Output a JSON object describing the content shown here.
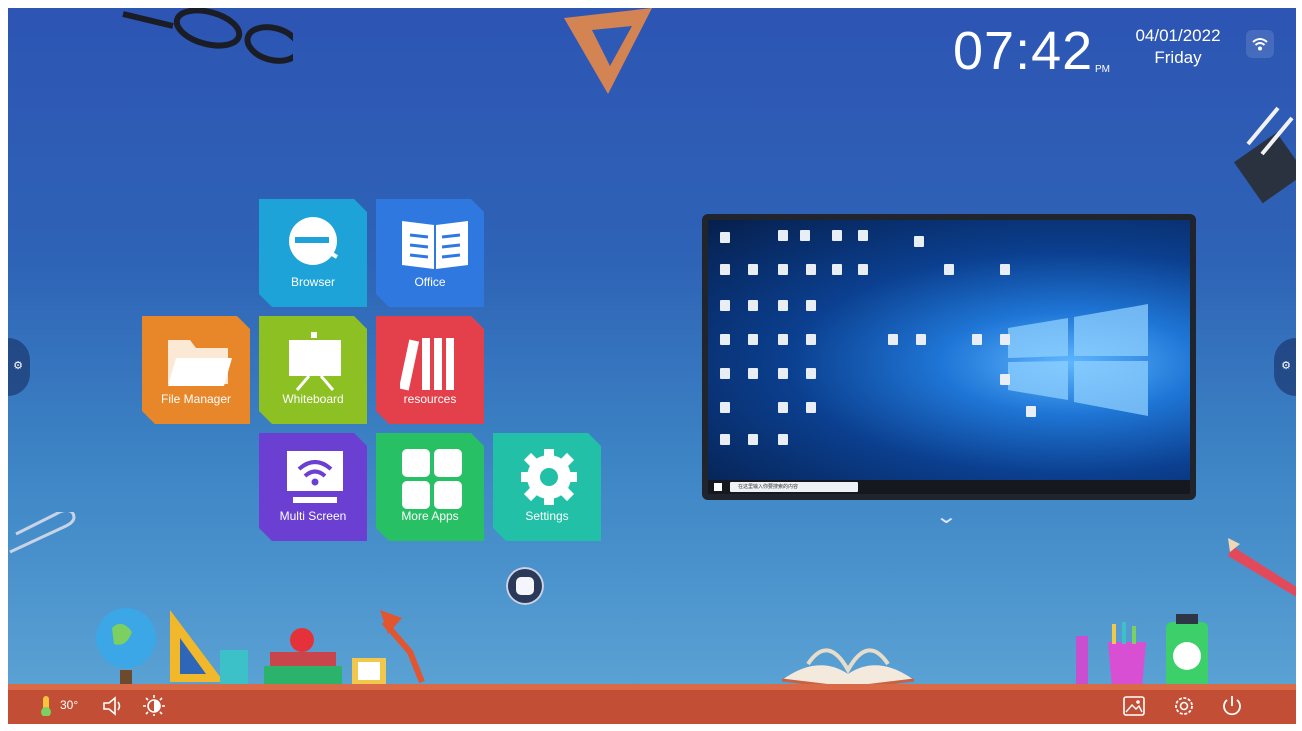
{
  "status": {
    "time": "07:42",
    "ampm": "PM",
    "date": "04/01/2022",
    "weekday": "Friday"
  },
  "apps": [
    {
      "label": "Browser",
      "color": "#1ea3d8",
      "icon": "browser-icon"
    },
    {
      "label": "Office",
      "color": "#2f78e0",
      "icon": "book-icon"
    },
    {
      "label": "File Manager",
      "color": "#e8862a",
      "icon": "folder-icon"
    },
    {
      "label": "Whiteboard",
      "color": "#8cc023",
      "icon": "easel-icon"
    },
    {
      "label": "resources",
      "color": "#e4404b",
      "icon": "books-icon"
    },
    {
      "label": "Multi Screen",
      "color": "#6a3fd2",
      "icon": "cast-icon"
    },
    {
      "label": "More Apps",
      "color": "#27c065",
      "icon": "grid-icon"
    },
    {
      "label": "Settings",
      "color": "#23c0a8",
      "icon": "gear-icon"
    }
  ],
  "preview": {
    "search_placeholder": "在这里输入你要搜索的内容"
  },
  "bottom_bar": {
    "temperature": "30°"
  },
  "colors": {
    "bar": "#c24f35",
    "background_top": "#2d55b4",
    "background_bottom": "#5fa6d6"
  }
}
